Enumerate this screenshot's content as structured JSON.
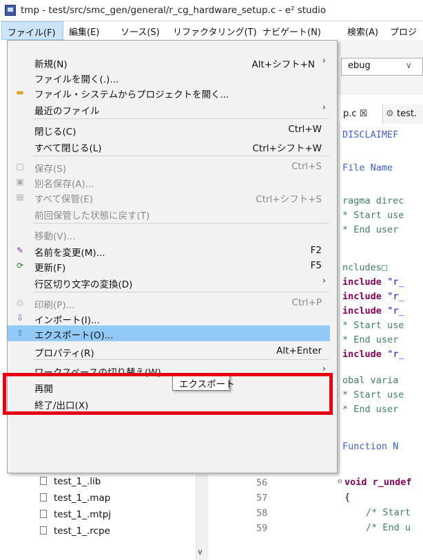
{
  "window": {
    "title": "tmp - test/src/smc_gen/general/r_cg_hardware_setup.c - e² studio"
  },
  "menubar": {
    "items": [
      "ファイル(F)",
      "編集(E)",
      "ソース(S)",
      "リファクタリング(T)",
      "ナビゲート(N)",
      "検索(A)",
      "プロジ"
    ]
  },
  "toolbar": {
    "combo_value": "ebug"
  },
  "tabs": [
    "p.c ☒",
    "test."
  ],
  "editor_lines": [
    {
      "cls": "dis",
      "text": "DISCLAIMEF"
    },
    {
      "cls": "dis",
      "text": "File Name"
    },
    {
      "cls": "cmt",
      "text": "ragma direc"
    },
    {
      "cls": "cmt",
      "text": "* Start use"
    },
    {
      "cls": "cmt",
      "text": "* End user"
    },
    {
      "cls": "cmt",
      "text": "ncludes□"
    },
    {
      "cls": "kw",
      "text": "include ",
      "str": "\"r_"
    },
    {
      "cls": "kw",
      "text": "include ",
      "str": "\"r_"
    },
    {
      "cls": "kw",
      "text": "include ",
      "str": "\"r_"
    },
    {
      "cls": "cmt",
      "text": "* Start use"
    },
    {
      "cls": "cmt",
      "text": "* End user"
    },
    {
      "cls": "kw",
      "text": "include ",
      "str": "\"r_"
    },
    {
      "cls": "cmt",
      "text": "obal varia"
    },
    {
      "cls": "cmt",
      "text": "* Start use"
    },
    {
      "cls": "cmt",
      "text": "* End user"
    },
    {
      "cls": "dis",
      "text": "Function N"
    }
  ],
  "code_tail": {
    "void_line": "void r_undef",
    "brace": "{",
    "comment1": "/* Start",
    "comment2": "/* End u"
  },
  "explorer": {
    "items": [
      "test_1_.lib",
      "test_1_.map",
      "test_1_.mtpj",
      "test_1_.rcpe"
    ],
    "line_numbers": [
      "56",
      "57",
      "58",
      "59"
    ]
  },
  "file_menu": {
    "items": [
      {
        "key": "new",
        "label": "新規(N)",
        "shortcut": "Alt+シフト+N",
        "arrow": true,
        "disabled": false,
        "icon": ""
      },
      {
        "key": "open_file",
        "label": "ファイルを開く(.)...",
        "shortcut": "",
        "arrow": false,
        "disabled": false,
        "icon": ""
      },
      {
        "key": "open_projects",
        "label": "ファイル・システムからプロジェクトを開く...",
        "shortcut": "",
        "arrow": false,
        "disabled": false,
        "icon": "folder-icon"
      },
      {
        "key": "recent",
        "label": "最近のファイル",
        "shortcut": "",
        "arrow": true,
        "disabled": false,
        "icon": ""
      },
      {
        "key": "close",
        "label": "閉じる(C)",
        "shortcut": "Ctrl+W",
        "arrow": false,
        "disabled": false,
        "icon": ""
      },
      {
        "key": "close_all",
        "label": "すべて閉じる(L)",
        "shortcut": "Ctrl+シフト+W",
        "arrow": false,
        "disabled": false,
        "icon": ""
      },
      {
        "key": "save",
        "label": "保存(S)",
        "shortcut": "Ctrl+S",
        "arrow": false,
        "disabled": true,
        "icon": "save-icon"
      },
      {
        "key": "save_as",
        "label": "別名保存(A)...",
        "shortcut": "",
        "arrow": false,
        "disabled": true,
        "icon": "save-as-icon"
      },
      {
        "key": "save_all",
        "label": "すべて保管(E)",
        "shortcut": "Ctrl+シフト+S",
        "arrow": false,
        "disabled": true,
        "icon": "save-all-icon"
      },
      {
        "key": "revert",
        "label": "前回保管した状態に戻す(T)",
        "shortcut": "",
        "arrow": false,
        "disabled": true,
        "icon": ""
      },
      {
        "key": "move",
        "label": "移動(V)...",
        "shortcut": "",
        "arrow": false,
        "disabled": true,
        "icon": ""
      },
      {
        "key": "rename",
        "label": "名前を変更(M)...",
        "shortcut": "F2",
        "arrow": false,
        "disabled": false,
        "icon": "rename-icon"
      },
      {
        "key": "refresh",
        "label": "更新(F)",
        "shortcut": "F5",
        "arrow": false,
        "disabled": false,
        "icon": "refresh-icon"
      },
      {
        "key": "line_delim",
        "label": "行区切り文字の変換(D)",
        "shortcut": "",
        "arrow": true,
        "disabled": false,
        "icon": ""
      },
      {
        "key": "print",
        "label": "印刷(P)...",
        "shortcut": "Ctrl+P",
        "arrow": false,
        "disabled": true,
        "icon": "print-icon"
      },
      {
        "key": "import",
        "label": "インポート(I)...",
        "shortcut": "",
        "arrow": false,
        "disabled": false,
        "icon": "import-icon"
      },
      {
        "key": "export",
        "label": "エクスポート(O)...",
        "shortcut": "",
        "arrow": false,
        "disabled": false,
        "icon": "export-icon"
      },
      {
        "key": "properties",
        "label": "プロパティ(R)",
        "shortcut": "Alt+Enter",
        "arrow": false,
        "disabled": false,
        "icon": ""
      },
      {
        "key": "switch_ws",
        "label": "ワークスペースの切り替え(W)",
        "shortcut": "",
        "arrow": true,
        "disabled": false,
        "icon": ""
      },
      {
        "key": "restart",
        "label": "再開",
        "shortcut": "",
        "arrow": false,
        "disabled": false,
        "icon": ""
      },
      {
        "key": "exit",
        "label": "終了/出口(X)",
        "shortcut": "",
        "arrow": false,
        "disabled": false,
        "icon": ""
      }
    ]
  },
  "tooltip": {
    "text": "エクスポート"
  },
  "colors": {
    "selection": "#91c9f7",
    "highlight_border": "#e60012",
    "menu_bg": "#f2f2f2"
  }
}
